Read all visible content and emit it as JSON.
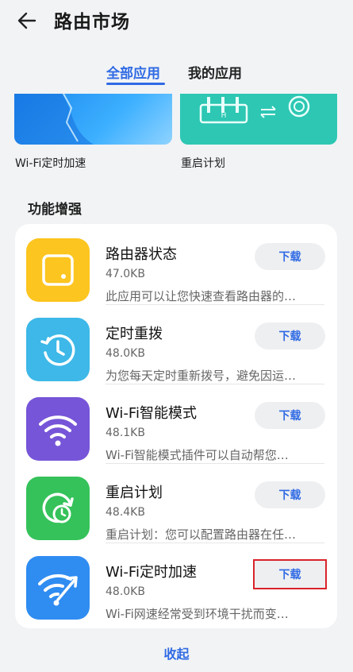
{
  "header": {
    "title": "路由市场",
    "back_icon": "arrow-left-icon"
  },
  "tabs": [
    {
      "label": "全部应用",
      "active": true
    },
    {
      "label": "我的应用",
      "active": false
    }
  ],
  "banners": [
    {
      "label": "Wi-Fi定时加速"
    },
    {
      "label": "重启计划"
    }
  ],
  "section": {
    "title": "功能增强"
  },
  "apps": [
    {
      "name": "路由器状态",
      "size": "47.0KB",
      "desc": "此应用可以让您快速查看路由器的…",
      "button": "下载",
      "icon": "router-status-icon",
      "color": "#fcc51f"
    },
    {
      "name": "定时重拨",
      "size": "48.0KB",
      "desc": "为您每天定时重新拨号，避免因运…",
      "button": "下载",
      "icon": "clock-redial-icon",
      "color": "#3db8e8"
    },
    {
      "name": "Wi-Fi智能模式",
      "size": "48.1KB",
      "desc": "Wi-Fi智能模式插件可以自动帮您…",
      "button": "下载",
      "icon": "wifi-icon",
      "color": "#7655d8"
    },
    {
      "name": "重启计划",
      "size": "48.4KB",
      "desc": "重启计划：您可以配置路由器在任…",
      "button": "下载",
      "icon": "restart-clock-icon",
      "color": "#35c25a"
    },
    {
      "name": "Wi-Fi定时加速",
      "size": "48.0KB",
      "desc": "Wi-Fi网速经常受到环境干扰而变…",
      "button": "下载",
      "icon": "wifi-boost-icon",
      "color": "#2f8cf1"
    }
  ],
  "footer": {
    "collapse_label": "收起"
  }
}
